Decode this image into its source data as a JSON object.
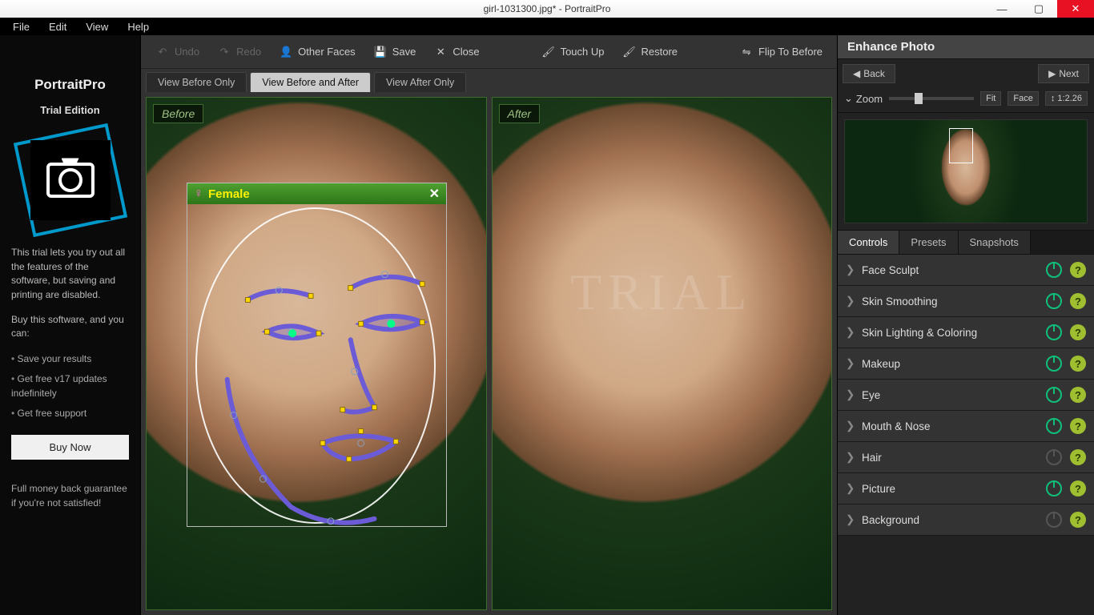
{
  "window": {
    "title": "girl-1031300.jpg* - PortraitPro"
  },
  "menu": {
    "file": "File",
    "edit": "Edit",
    "view": "View",
    "help": "Help"
  },
  "brand": {
    "title": "PortraitPro",
    "subtitle": "Trial Edition",
    "trial_text": "This trial lets you try out all the features of the software, but saving and printing are disabled.",
    "buy_prompt": "Buy this software, and you can:",
    "bullets": [
      "Save your results",
      "Get free v17 updates indefinitely",
      "Get free support"
    ],
    "buy_btn": "Buy Now",
    "guarantee": "Full money back guarantee if you're not satisfied!"
  },
  "toolbar": {
    "undo": "Undo",
    "redo": "Redo",
    "other_faces": "Other Faces",
    "save": "Save",
    "close": "Close",
    "touch_up": "Touch Up",
    "restore": "Restore",
    "flip": "Flip To Before"
  },
  "view_tabs": {
    "before_only": "View Before Only",
    "before_after": "View Before and After",
    "after_only": "View After Only"
  },
  "panes": {
    "before": "Before",
    "after": "After",
    "watermark": "TRIAL"
  },
  "face_overlay": {
    "label": "Female"
  },
  "right": {
    "header": "Enhance Photo",
    "back": "Back",
    "next": "Next",
    "zoom": "Zoom",
    "fit": "Fit",
    "face": "Face",
    "ratio": "1:2.26"
  },
  "ctrl_tabs": {
    "controls": "Controls",
    "presets": "Presets",
    "snapshots": "Snapshots"
  },
  "controls": [
    {
      "label": "Face Sculpt",
      "on": true
    },
    {
      "label": "Skin Smoothing",
      "on": true
    },
    {
      "label": "Skin Lighting & Coloring",
      "on": true
    },
    {
      "label": "Makeup",
      "on": true
    },
    {
      "label": "Eye",
      "on": true
    },
    {
      "label": "Mouth & Nose",
      "on": true
    },
    {
      "label": "Hair",
      "on": false
    },
    {
      "label": "Picture",
      "on": true
    },
    {
      "label": "Background",
      "on": false
    }
  ]
}
